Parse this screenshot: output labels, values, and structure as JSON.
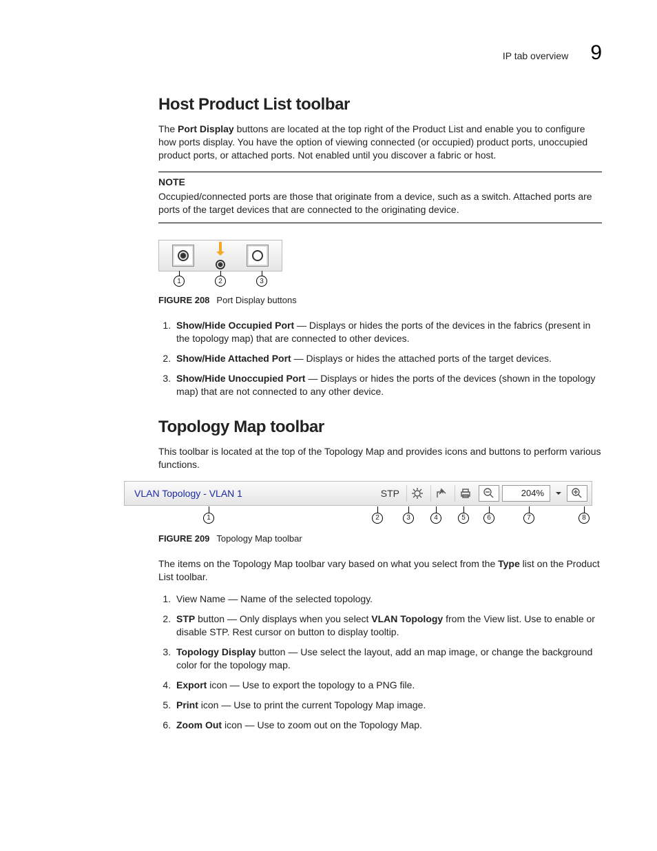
{
  "header": {
    "section_label": "IP tab overview",
    "chapter_number": "9"
  },
  "section1": {
    "title": "Host Product List toolbar",
    "intro_before_bold": "The ",
    "intro_bold": "Port Display",
    "intro_after_bold": " buttons are located at the top right of the Product List and enable you to configure how ports display. You have the option of viewing connected (or occupied) product ports, unoccupied product ports, or attached ports. Not enabled until you discover a fabric or host.",
    "note_label": "NOTE",
    "note_body": "Occupied/connected ports are those that originate from a device, such as a switch. Attached ports are ports of the target devices that are connected to the originating device.",
    "fig_num": "FIGURE 208",
    "fig_caption": "Port Display buttons",
    "list": [
      {
        "bold": "Show/Hide Occupied Port",
        "rest": " — Displays or hides the ports of the devices in the fabrics (present in the topology map) that are connected to other devices."
      },
      {
        "bold": "Show/Hide Attached Port",
        "rest": " — Displays or hides the attached ports of the target devices."
      },
      {
        "bold": "Show/Hide Unoccupied Port",
        "rest": " — Displays or hides the ports of the devices (shown in the topology map) that are not connected to any other device."
      }
    ]
  },
  "section2": {
    "title": "Topology Map toolbar",
    "intro": "This toolbar is located at the top of the Topology Map and provides icons and buttons to perform various functions.",
    "toolbar": {
      "view_name": "VLAN Topology - VLAN 1",
      "stp_label": "STP",
      "zoom_value": "204%"
    },
    "fig_num": "FIGURE 209",
    "fig_caption": "Topology Map toolbar",
    "para_before_bold": "The items on the Topology Map toolbar vary based on what you select from the ",
    "para_bold": "Type",
    "para_after_bold": " list on the Product List toolbar.",
    "list": [
      {
        "pre": "View Name — Name of the selected topology."
      },
      {
        "bold": "STP",
        "rest": " button — Only displays when you select ",
        "bold2": "VLAN Topology",
        "rest2": " from the View list. Use to enable or disable STP. Rest cursor on button to display tooltip."
      },
      {
        "bold": "Topology Display",
        "rest": " button — Use select the layout, add an map image, or change the background color for the topology map."
      },
      {
        "bold": "Export",
        "rest": " icon — Use to export the topology to a PNG file."
      },
      {
        "bold": "Print",
        "rest": " icon — Use to print the current Topology Map image."
      },
      {
        "bold": "Zoom Out",
        "rest": " icon — Use to zoom out on the Topology Map."
      }
    ]
  },
  "callouts": {
    "c1": "1",
    "c2": "2",
    "c3": "3",
    "c4": "4",
    "c5": "5",
    "c6": "6",
    "c7": "7",
    "c8": "8"
  }
}
